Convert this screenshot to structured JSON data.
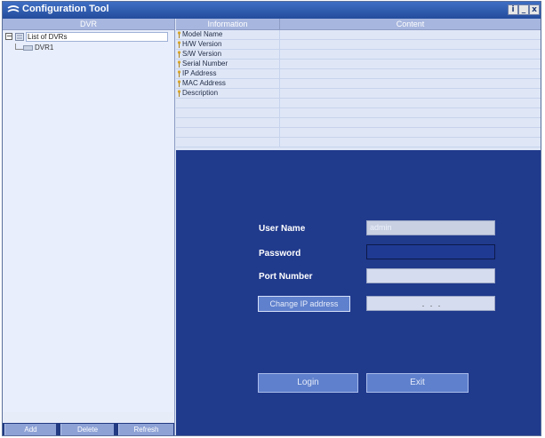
{
  "window": {
    "title": "Configuration Tool"
  },
  "left_panel": {
    "header": "DVR",
    "tree": {
      "root_label": "List of DVRs",
      "children": [
        "DVR1"
      ]
    },
    "buttons": {
      "add": "Add",
      "delete": "Delete",
      "refresh": "Refresh"
    }
  },
  "info_table": {
    "headers": {
      "information": "Information",
      "content": "Content"
    },
    "rows": [
      "Model Name",
      "H/W Version",
      "S/W Version",
      "Serial Number",
      "IP Address",
      "MAC Address",
      "Description"
    ]
  },
  "login": {
    "username_label": "User Name",
    "username_value": "admin",
    "password_label": "Password",
    "password_value": "",
    "port_label": "Port Number",
    "port_value": "",
    "change_ip_label": "Change IP address",
    "ip_value": ".     .     .",
    "login_button": "Login",
    "exit_button": "Exit"
  },
  "colors": {
    "title_bar": "#2f5db3",
    "login_background": "#203a8c",
    "button_blue": "#5f80cc"
  }
}
